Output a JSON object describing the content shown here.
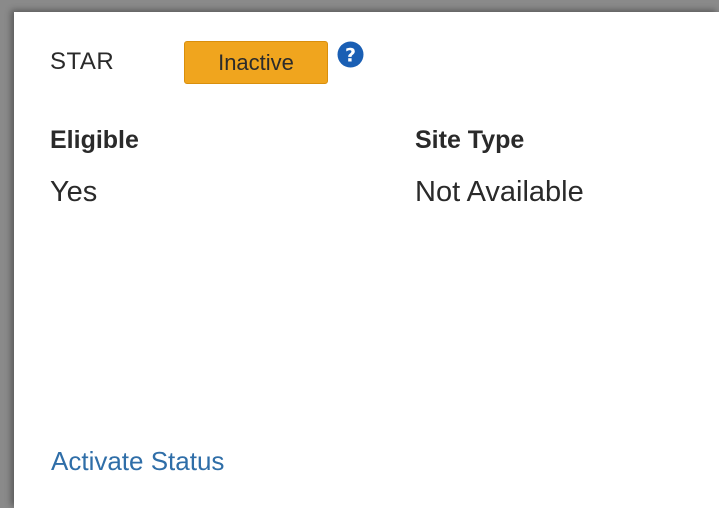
{
  "header": {
    "label": "STAR",
    "status_badge": "Inactive",
    "status_color": "#f0a51e",
    "help_icon": "question-circle-icon"
  },
  "fields": {
    "eligible": {
      "label": "Eligible",
      "value": "Yes"
    },
    "site_type": {
      "label": "Site Type",
      "value": "Not Available"
    }
  },
  "actions": {
    "activate_label": "Activate Status",
    "link_color": "#2f6ea8"
  }
}
